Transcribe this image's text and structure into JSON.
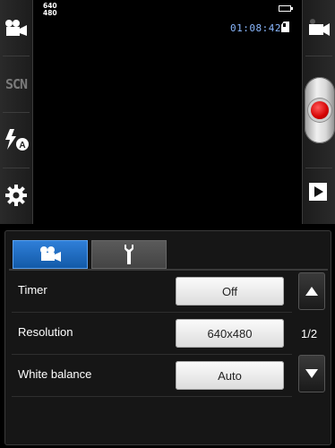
{
  "left_rail": {
    "items": [
      {
        "icon": "video-mode-icon"
      },
      {
        "icon": "scene-icon",
        "label": "SCN"
      },
      {
        "icon": "flash-auto-icon"
      },
      {
        "icon": "settings-gear-icon"
      }
    ]
  },
  "viewfinder": {
    "resolution_indicator": {
      "line1": "640",
      "line2": "480"
    },
    "recording_timer": "01:08:42",
    "battery_icon": "battery-icon",
    "storage_icon": "sd-card-icon"
  },
  "right_rail": {
    "mode_switch_icon": "camcorder-icon",
    "record_button_icon": "record-icon",
    "playback_icon": "play-icon"
  },
  "settings_panel": {
    "tabs": [
      {
        "icon": "camcorder-tab-icon",
        "active": true
      },
      {
        "icon": "wrench-tab-icon",
        "active": false
      }
    ],
    "rows": [
      {
        "label": "Timer",
        "value": "Off"
      },
      {
        "label": "Resolution",
        "value": "640x480"
      },
      {
        "label": "White balance",
        "value": "Auto"
      }
    ],
    "pager": {
      "page": "1/2"
    }
  },
  "colors": {
    "accent_tab": "#1f6fc5",
    "record": "#d40000",
    "timer_text": "#8ab8ff"
  }
}
